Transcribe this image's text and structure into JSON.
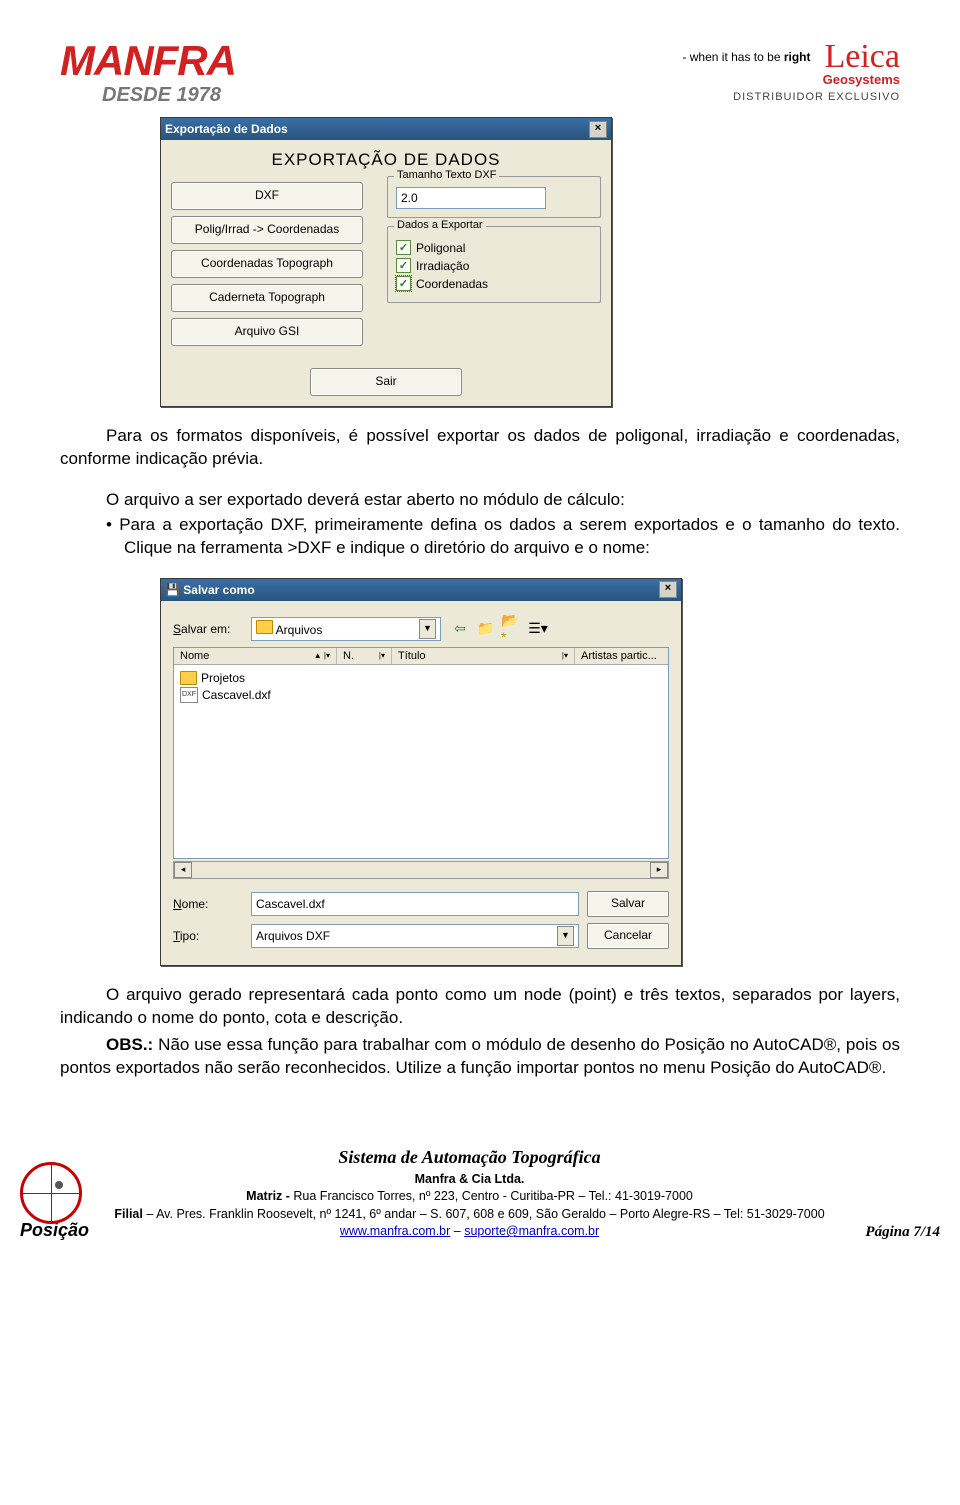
{
  "header": {
    "brand": "MANFRA",
    "since": "DESDE 1978",
    "tagline_prefix": "- when it has to be ",
    "tagline_bold": "right",
    "leica": "Leica",
    "geosystems": "Geosystems",
    "distributor": "DISTRIBUIDOR EXCLUSIVO"
  },
  "dlg1": {
    "title": "Exportação de Dados",
    "heading": "EXPORTAÇÃO DE DADOS",
    "buttons": {
      "dxf": "DXF",
      "polig": "Polig/Irrad -> Coordenadas",
      "coord": "Coordenadas Topograph",
      "cadern": "Caderneta Topograph",
      "gsi": "Arquivo GSI"
    },
    "group_tam": "Tamanho Texto DXF",
    "tam_val": "2.0",
    "group_dados": "Dados a Exportar",
    "checks": {
      "poligonal": "Poligonal",
      "irrad": "Irradiação",
      "coord": "Coordenadas"
    },
    "sair": "Sair"
  },
  "para1": "Para os formatos disponíveis, é possível exportar os dados de poligonal, irradiação e coordenadas, conforme indicação prévia.",
  "para2": "O arquivo a ser exportado deverá estar aberto no módulo de cálculo:",
  "bullet1": "Para a exportação DXF, primeiramente defina os dados a serem exportados e o tamanho do texto. Clique na ferramenta >DXF e indique o diretório do arquivo e o nome:",
  "dlg2": {
    "title": "Salvar como",
    "salvar_em": "Salvar em:",
    "folder": "Arquivos",
    "cols": {
      "nome": "Nome",
      "n": "N.",
      "titulo": "Título",
      "art": "Artistas partic..."
    },
    "items": {
      "projetos": "Projetos",
      "cascavel": "Cascavel.dxf"
    },
    "file_ico": "DXF",
    "nome_lbl": "Nome:",
    "nome_val": "Cascavel.dxf",
    "tipo_lbl": "Tipo:",
    "tipo_val": "Arquivos DXF",
    "salvar": "Salvar",
    "cancelar": "Cancelar"
  },
  "para3": "O arquivo gerado representará cada ponto como um node (point) e três textos, separados por layers, indicando o nome do ponto, cota e descrição.",
  "obs_label": "OBS.:",
  "para4": " Não use essa função para trabalhar com o módulo de desenho do Posição no AutoCAD®, pois os pontos exportados não serão reconhecidos. Utilize a função importar pontos no menu Posição do AutoCAD®.",
  "footer": {
    "pos": "Posição",
    "sat": "Sistema de Automação Topográfica",
    "company": "Manfra & Cia Ltda.",
    "matriz_b": "Matriz - ",
    "matriz": "Rua Francisco Torres, nº 223, Centro - Curitiba-PR – Tel.: 41-3019-7000",
    "filial_b": "Filial",
    "filial": " – Av. Pres. Franklin Roosevelt, nº 1241, 6º andar – S. 607, 608 e 609,  São Geraldo – Porto Alegre-RS – Tel: 51-3029-7000",
    "url": "www.manfra.com.br",
    "sep": " – ",
    "email": "suporte@manfra.com.br",
    "page": "Página 7/14"
  }
}
